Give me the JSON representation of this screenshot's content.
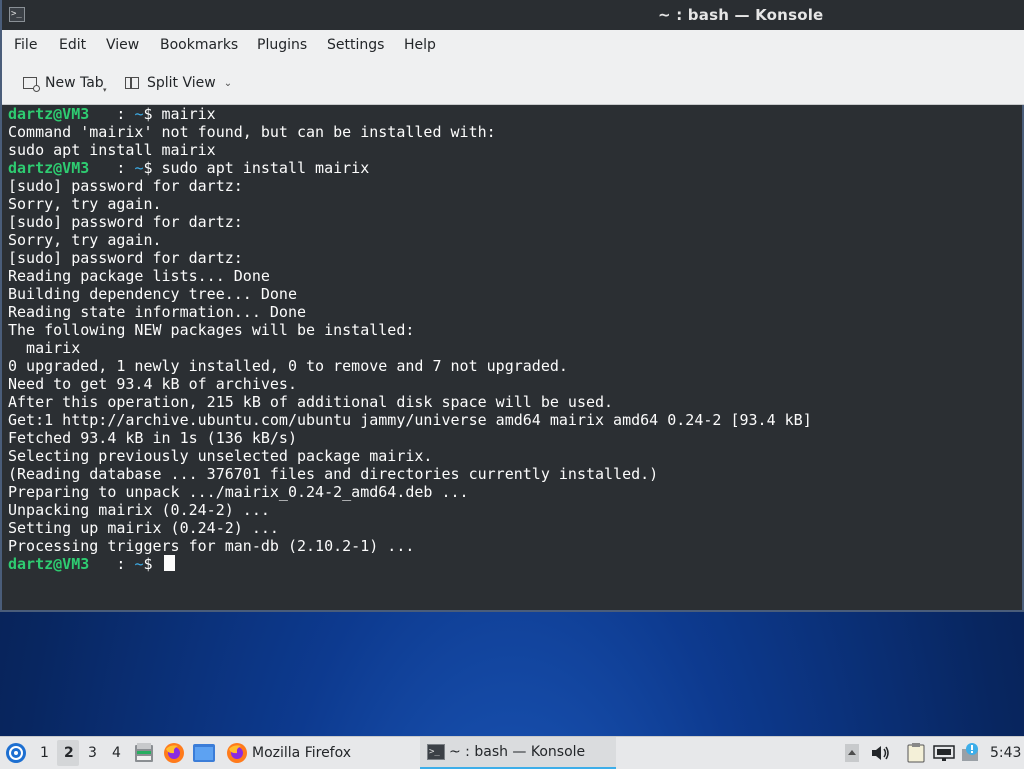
{
  "window": {
    "title": "~ : bash — Konsole"
  },
  "menubar": {
    "items": [
      "File",
      "Edit",
      "View",
      "Bookmarks",
      "Plugins",
      "Settings",
      "Help"
    ]
  },
  "toolbar": {
    "new_tab_label": "New Tab",
    "split_view_label": "Split View"
  },
  "terminal": {
    "prompt_user": "dartz@VM3",
    "prompt_sep": "  : ",
    "prompt_path": "~",
    "prompt_sym": "$ ",
    "lines": [
      {
        "prompt": true,
        "cmd": "mairix"
      },
      {
        "text": "Command 'mairix' not found, but can be installed with:"
      },
      {
        "text": "sudo apt install mairix"
      },
      {
        "prompt": true,
        "cmd": "sudo apt install mairix"
      },
      {
        "text": "[sudo] password for dartz:"
      },
      {
        "text": "Sorry, try again."
      },
      {
        "text": "[sudo] password for dartz:"
      },
      {
        "text": "Sorry, try again."
      },
      {
        "text": "[sudo] password for dartz:"
      },
      {
        "text": "Reading package lists... Done"
      },
      {
        "text": "Building dependency tree... Done"
      },
      {
        "text": "Reading state information... Done"
      },
      {
        "text": "The following NEW packages will be installed:"
      },
      {
        "text": "  mairix"
      },
      {
        "text": "0 upgraded, 1 newly installed, 0 to remove and 7 not upgraded."
      },
      {
        "text": "Need to get 93.4 kB of archives."
      },
      {
        "text": "After this operation, 215 kB of additional disk space will be used."
      },
      {
        "text": "Get:1 http://archive.ubuntu.com/ubuntu jammy/universe amd64 mairix amd64 0.24-2 [93.4 kB]"
      },
      {
        "text": "Fetched 93.4 kB in 1s (136 kB/s)"
      },
      {
        "text": "Selecting previously unselected package mairix."
      },
      {
        "text": "(Reading database ... 376701 files and directories currently installed.)"
      },
      {
        "text": "Preparing to unpack .../mairix_0.24-2_amd64.deb ..."
      },
      {
        "text": "Unpacking mairix (0.24-2) ..."
      },
      {
        "text": "Setting up mairix (0.24-2) ..."
      },
      {
        "text": "Processing triggers for man-db (2.10.2-1) ..."
      },
      {
        "prompt": true,
        "cmd": "",
        "cursor": true
      }
    ]
  },
  "taskbar": {
    "desktops": [
      "1",
      "2",
      "3",
      "4"
    ],
    "active_desktop": "2",
    "firefox_task_label": "Mozilla Firefox",
    "konsole_task_label": "~ : bash — Konsole",
    "clock": "5:43"
  },
  "colors": {
    "prompt_user": "#2ecc71",
    "prompt_path": "#3daee9",
    "terminal_bg": "#2b2f33",
    "accent": "#3daee9"
  }
}
